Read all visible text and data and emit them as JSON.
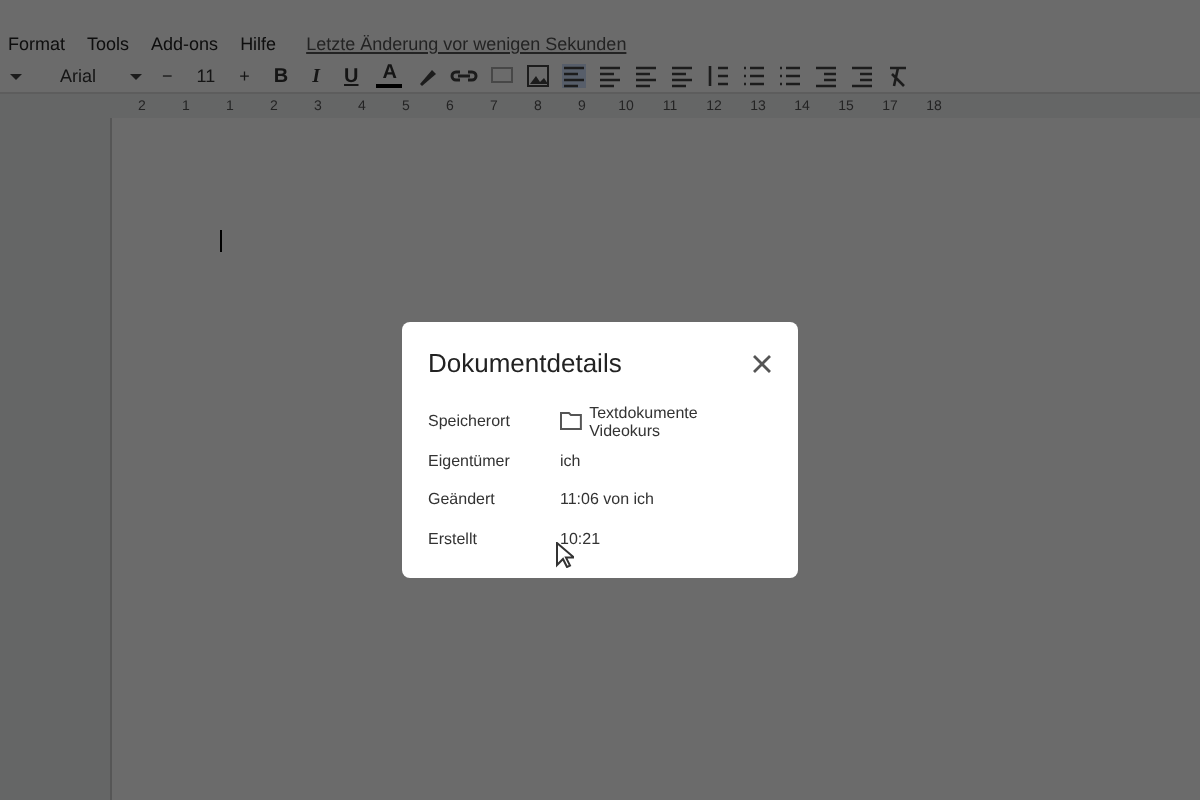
{
  "menu": [
    "Format",
    "Tools",
    "Add-ons",
    "Hilfe"
  ],
  "last_edit": "Letzte Änderung vor wenigen Sekunden",
  "toolbar": {
    "font": "Arial",
    "font_size": "11",
    "minus": "−",
    "plus": "+",
    "format_letters": [
      "B",
      "I",
      "U",
      "A"
    ]
  },
  "ruler": [
    "2",
    "1",
    "1",
    "2",
    "3",
    "4",
    "5",
    "6",
    "7",
    "8",
    "9",
    "10",
    "11",
    "12",
    "13",
    "14",
    "15",
    "17",
    "18"
  ],
  "dialog": {
    "title": "Dokumentdetails",
    "rows": [
      {
        "label": "Speicherort",
        "value": "Textdokumente Videokurs",
        "kind": "folder"
      },
      {
        "label": "Eigentümer",
        "value": "ich",
        "kind": "text"
      },
      {
        "label": "Geändert",
        "value": "11:06 von ich",
        "kind": "text"
      },
      {
        "label": "Erstellt",
        "value": "10:21",
        "kind": "text"
      }
    ]
  }
}
